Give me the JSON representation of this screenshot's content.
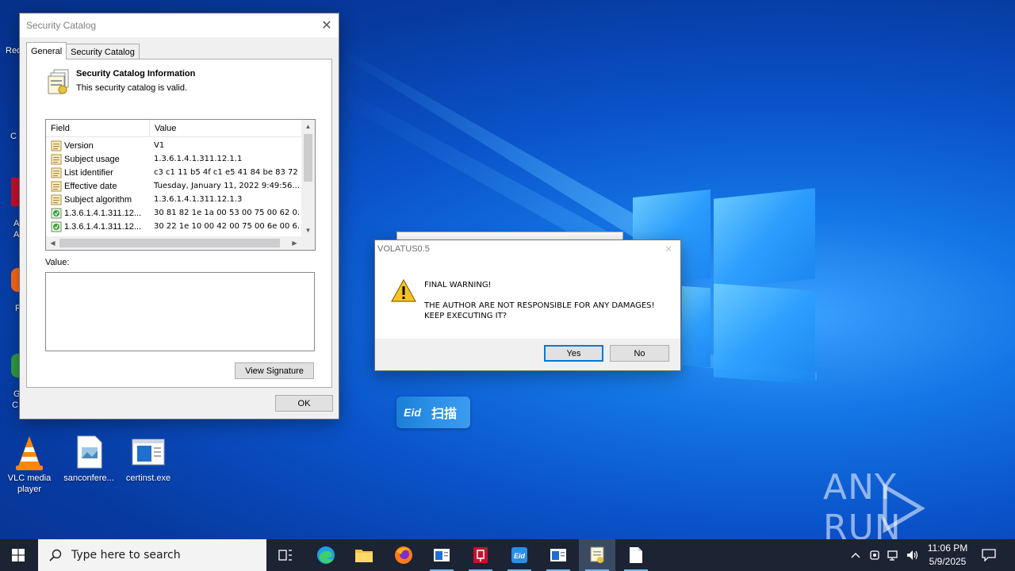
{
  "desktop": {
    "icons": [
      {
        "label": "VLC media player",
        "line1": "VLC media",
        "line2": "player"
      },
      {
        "label": "sanconfere..."
      },
      {
        "label": "certinst.exe"
      }
    ],
    "fragments": [
      "Rec",
      "C",
      "A",
      "A",
      "F",
      "G",
      "C"
    ]
  },
  "catalog_dialog": {
    "title": "Security Catalog",
    "tabs": [
      "General",
      "Security Catalog"
    ],
    "info_title": "Security Catalog Information",
    "info_subtitle": "This security catalog is valid.",
    "columns": [
      "Field",
      "Value"
    ],
    "rows": [
      {
        "field": "Version",
        "value": "V1",
        "icon": "document-icon"
      },
      {
        "field": "Subject usage",
        "value": "1.3.6.1.4.1.311.12.1.1",
        "icon": "document-icon"
      },
      {
        "field": "List identifier",
        "value": "c3 c1 11 b5 4f c1 e5 41 84 be 83 72 ...",
        "icon": "document-icon"
      },
      {
        "field": "Effective date",
        "value": "Tuesday, January 11, 2022 9:49:56...",
        "icon": "document-icon"
      },
      {
        "field": "Subject algorithm",
        "value": "1.3.6.1.4.1.311.12.1.3",
        "icon": "document-icon"
      },
      {
        "field": "1.3.6.1.4.1.311.12...",
        "value": "30 81 82 1e 1a 00 53 00 75 00 62 0...",
        "icon": "extension-icon"
      },
      {
        "field": "1.3.6.1.4.1.311.12...",
        "value": "30 22 1e 10 00 42 00 75 00 6e 00 6...",
        "icon": "extension-icon"
      }
    ],
    "value_label": "Value:",
    "view_signature_label": "View Signature",
    "ok_label": "OK"
  },
  "volatus_dialog": {
    "title": "VOLATUS0.5",
    "line1": "FINAL WARNING!",
    "line2": "THE AUTHOR ARE NOT RESPONSIBLE FOR ANY DAMAGES!",
    "line3": "KEEP EXECUTING IT?",
    "yes_label": "Yes",
    "no_label": "No"
  },
  "eid_widget": {
    "logo": "Eid",
    "text": "扫描"
  },
  "watermark": {
    "text": "ANY RUN"
  },
  "taskbar": {
    "search_placeholder": "Type here to search",
    "time": "11:06 PM",
    "date": "5/9/2025"
  },
  "colors": {
    "desktop_blue": "#0a52c9",
    "taskbar": "#1c2333",
    "accent": "#0078d7"
  }
}
